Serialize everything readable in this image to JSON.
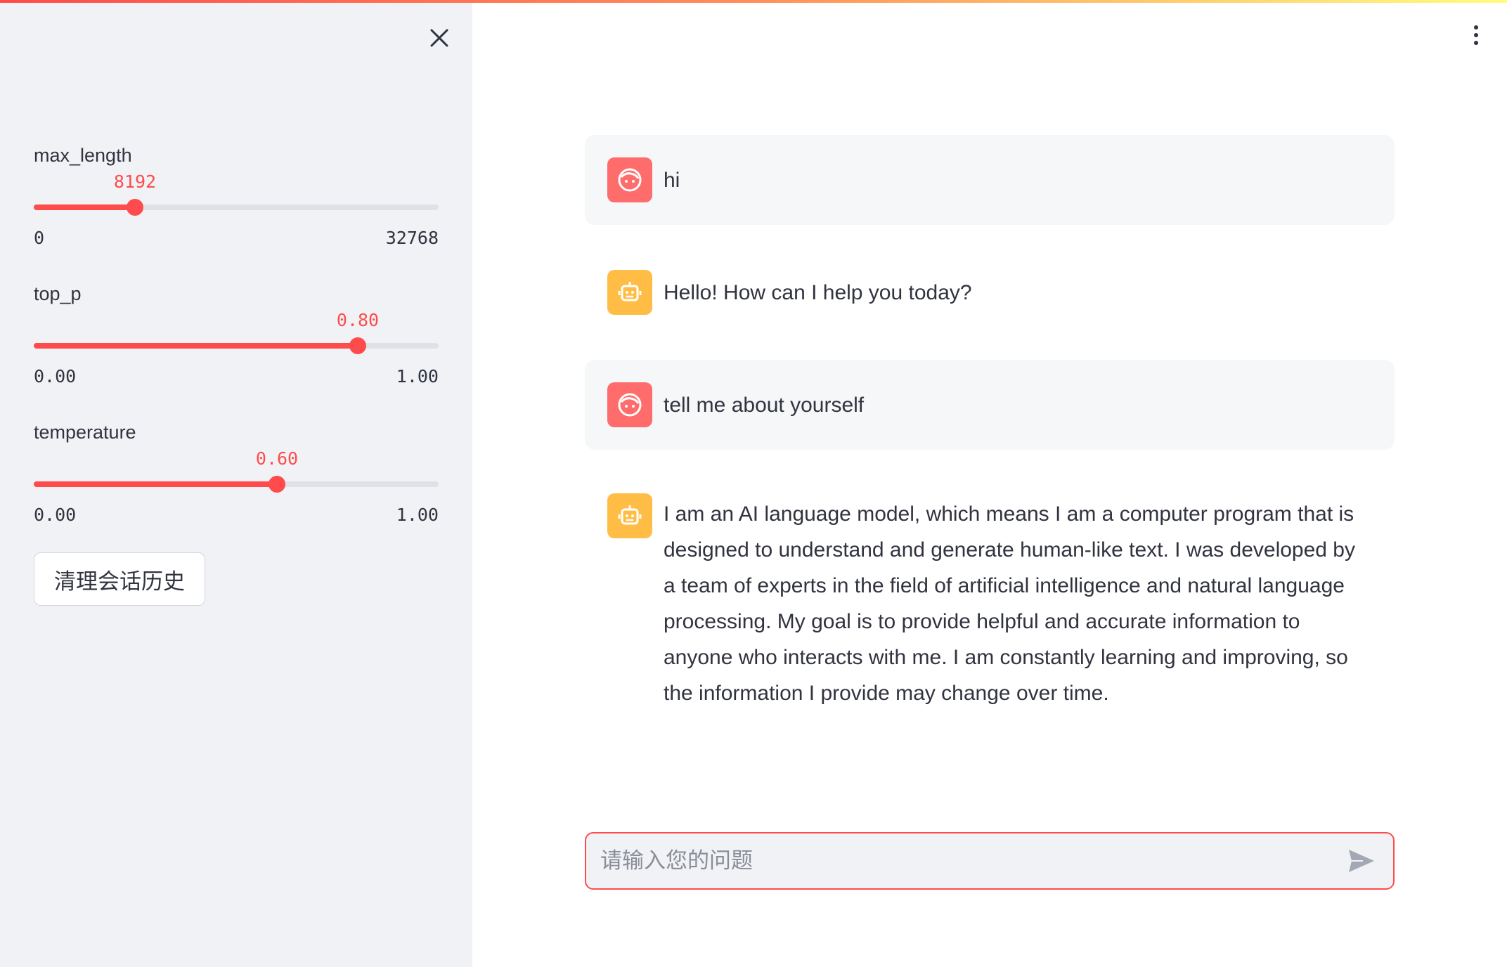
{
  "sidebar": {
    "sliders": [
      {
        "label": "max_length",
        "value_text": "8192",
        "min_text": "0",
        "max_text": "32768",
        "fraction": 0.25
      },
      {
        "label": "top_p",
        "value_text": "0.80",
        "min_text": "0.00",
        "max_text": "1.00",
        "fraction": 0.8
      },
      {
        "label": "temperature",
        "value_text": "0.60",
        "min_text": "0.00",
        "max_text": "1.00",
        "fraction": 0.6
      }
    ],
    "clear_button_label": "清理会话历史"
  },
  "chat": {
    "messages": [
      {
        "role": "user",
        "text": "hi"
      },
      {
        "role": "assistant",
        "text": "Hello! How can I help you today?"
      },
      {
        "role": "user",
        "text": "tell me about yourself"
      },
      {
        "role": "assistant",
        "text": "I am an AI language model, which means I am a computer program that is designed to understand and generate human-like text. I was developed by a team of experts in the field of artificial intelligence and natural language processing. My goal is to provide helpful and accurate information to anyone who interacts with me. I am constantly learning and improving, so the information I provide may change over time."
      }
    ],
    "input": {
      "placeholder": "请输入您的问题",
      "value": ""
    }
  },
  "colors": {
    "accent": "#ff4b4b",
    "user_avatar": "#ff6c6c",
    "bot_avatar": "#ffbd45",
    "sidebar_bg": "#f0f2f6"
  },
  "icons": [
    "close-icon",
    "more-vertical-icon",
    "user-face-icon",
    "robot-icon",
    "send-icon"
  ]
}
